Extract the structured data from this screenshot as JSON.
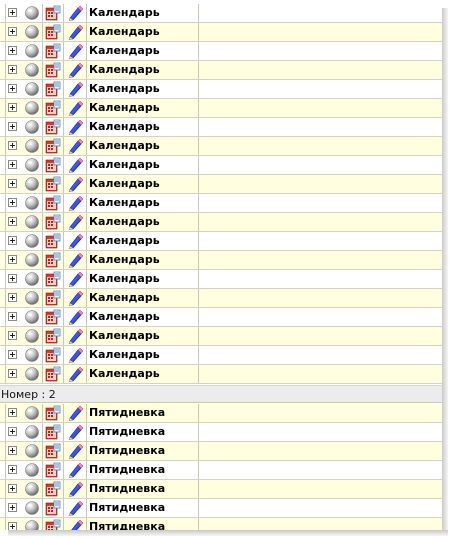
{
  "group1": {
    "rows": [
      {
        "name": "Календарь"
      },
      {
        "name": "Календарь"
      },
      {
        "name": "Календарь"
      },
      {
        "name": "Календарь"
      },
      {
        "name": "Календарь"
      },
      {
        "name": "Календарь"
      },
      {
        "name": "Календарь"
      },
      {
        "name": "Календарь"
      },
      {
        "name": "Календарь"
      },
      {
        "name": "Календарь"
      },
      {
        "name": "Календарь"
      },
      {
        "name": "Календарь"
      },
      {
        "name": "Календарь"
      },
      {
        "name": "Календарь"
      },
      {
        "name": "Календарь"
      },
      {
        "name": "Календарь"
      },
      {
        "name": "Календарь"
      },
      {
        "name": "Календарь"
      },
      {
        "name": "Календарь"
      },
      {
        "name": "Календарь"
      }
    ]
  },
  "group2": {
    "header": "Номер : 2",
    "rows": [
      {
        "name": "Пятидневка"
      },
      {
        "name": "Пятидневка"
      },
      {
        "name": "Пятидневка"
      },
      {
        "name": "Пятидневка"
      },
      {
        "name": "Пятидневка"
      },
      {
        "name": "Пятидневка"
      },
      {
        "name": "Пятидневка"
      }
    ]
  },
  "icons": {
    "expand": "plus-box-icon",
    "ball": "sphere-icon",
    "calendar": "calendar-icon",
    "edit": "pencil-icon"
  },
  "colors": {
    "row_alt": "#ffffe0",
    "row": "#ffffff",
    "group_header": "#ececec"
  }
}
